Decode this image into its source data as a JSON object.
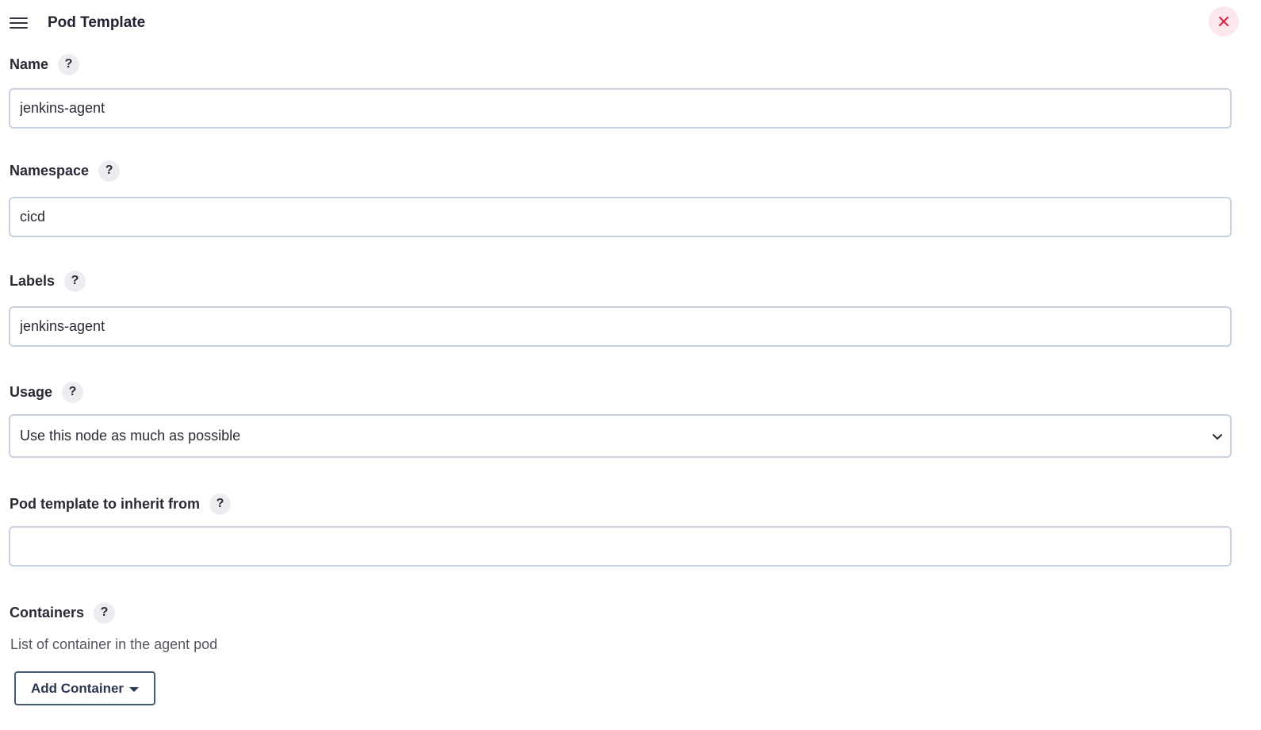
{
  "header": {
    "title": "Pod Template",
    "drag_icon": "hamburger-icon",
    "close_icon": "close-icon",
    "close_color": "#e0203c"
  },
  "fields": {
    "name": {
      "label": "Name",
      "help": "?",
      "value": "jenkins-agent"
    },
    "namespace": {
      "label": "Namespace",
      "help": "?",
      "value": "cicd"
    },
    "labels": {
      "label": "Labels",
      "help": "?",
      "value": "jenkins-agent"
    },
    "usage": {
      "label": "Usage",
      "help": "?",
      "selected": "Use this node as much as possible"
    },
    "inherit_from": {
      "label": "Pod template to inherit from",
      "help": "?",
      "value": ""
    }
  },
  "containers": {
    "label": "Containers",
    "help": "?",
    "description": "List of container in the agent pod",
    "add_button": "Add Container"
  }
}
